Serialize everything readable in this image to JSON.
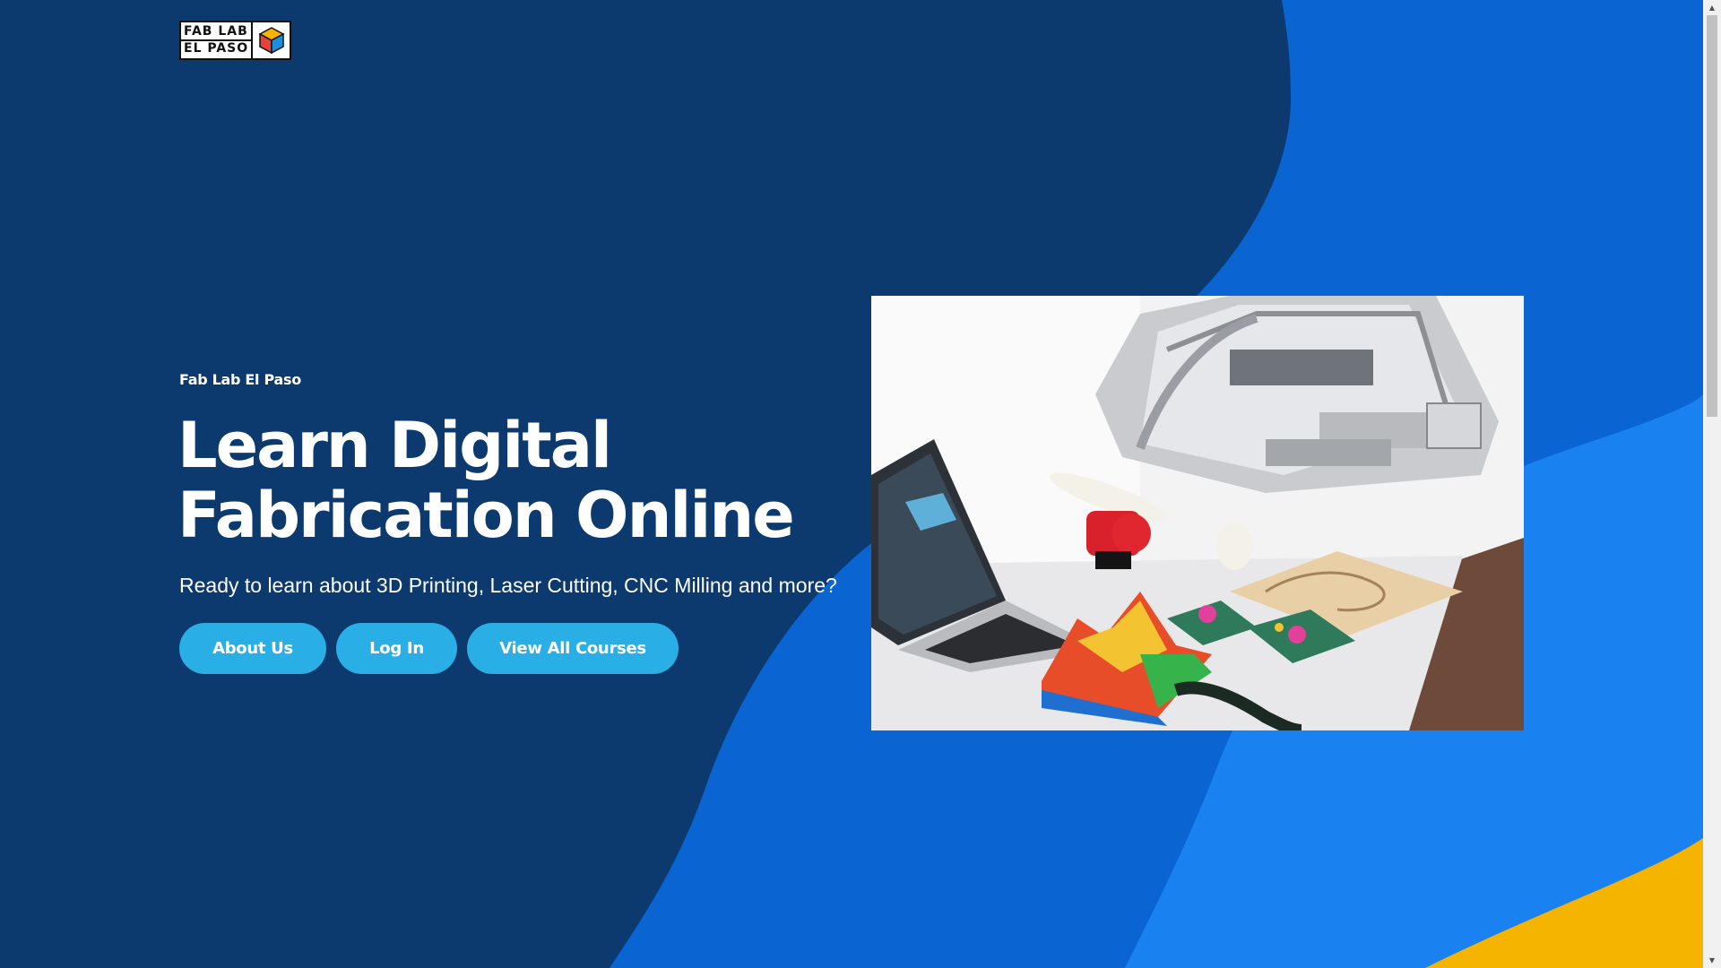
{
  "logo": {
    "line1": "FAB LAB",
    "line2": "EL PASO"
  },
  "hero": {
    "eyebrow": "Fab Lab El Paso",
    "headline_line1": "Learn Digital",
    "headline_line2": "Fabrication Online",
    "subtext": "Ready to learn about 3D Printing, Laser Cutting, CNC Milling and more?"
  },
  "buttons": {
    "about": "About Us",
    "login": "Log In",
    "courses": "View All Courses"
  },
  "colors": {
    "background_dark": "#0d3a6e",
    "wave_blue": "#0a64d2",
    "wave_light_blue": "#1a82f0",
    "accent_yellow": "#f5b400",
    "button": "#2aaee6"
  },
  "icons": {
    "logo_cube": "cube-icon",
    "scroll_up": "chevron-up-icon",
    "scroll_down": "chevron-down-icon"
  }
}
